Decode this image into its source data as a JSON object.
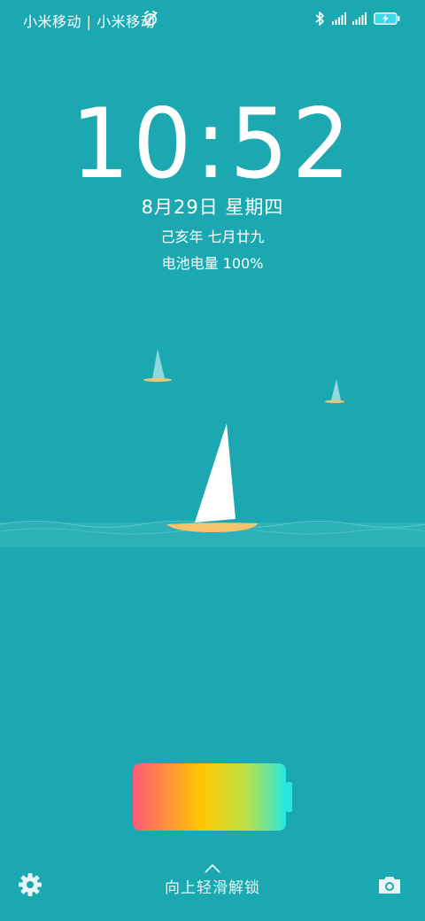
{
  "status_bar": {
    "carrier_text": "小米移动 | 小米移动",
    "icons": [
      "alarm-off-icon",
      "bluetooth-icon",
      "signal-icon",
      "signal-icon",
      "charging-battery-icon"
    ]
  },
  "lock": {
    "time": "10:52",
    "date": "8月29日 星期四",
    "lunar": "己亥年 七月廿九",
    "battery_status": "电池电量 100%",
    "charge_level": 1.0
  },
  "bottom": {
    "unlock_hint": "向上轻滑解锁",
    "left_icon": "settings-icon",
    "right_icon": "camera-icon"
  },
  "colors": {
    "background": "#1ba8b0",
    "sand": "#f7c36b",
    "sail": "#ffffff",
    "battery_gradient": [
      "#ff5a78",
      "#ffc800",
      "#27e8e0"
    ]
  }
}
